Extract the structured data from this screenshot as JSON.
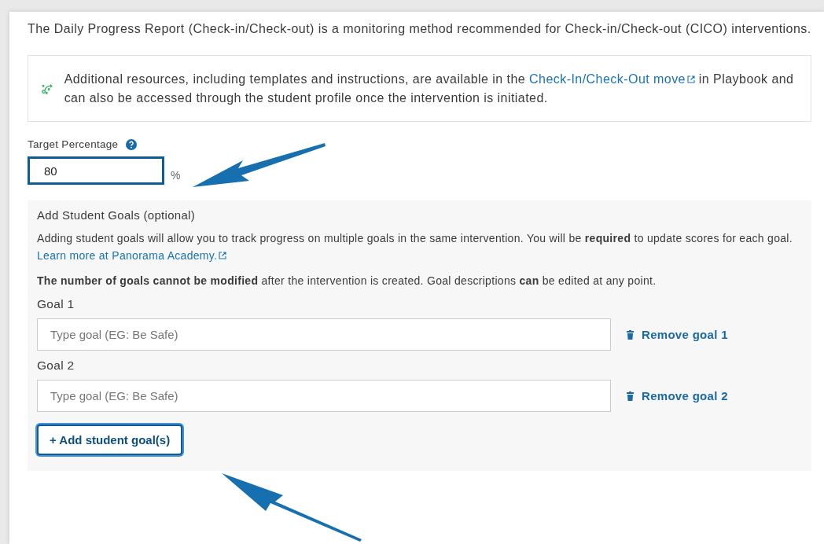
{
  "intro": "The Daily Progress Report (Check-in/Check-out) is a monitoring method recommended for Check-in/Check-out (CICO) interventions.",
  "resource_note": {
    "text_before": "Additional resources, including templates and instructions, are available in the",
    "link": "Check-In/Check-Out move",
    "text_after": "in Playbook and can also be accessed through the student profile once the intervention is initiated."
  },
  "target": {
    "label": "Target Percentage",
    "value": "80",
    "unit": "%",
    "focused": true
  },
  "goals_section": {
    "title": "Add Student Goals (optional)",
    "description": "Adding student goals will allow you to track progress on multiple goals in the same intervention. You will be **required** to update scores for each goal.",
    "description_link": "Learn more at Panorama Academy.",
    "notice": "**The number of goals cannot be modified** after the intervention is created. Goal descriptions **can** be edited at any point.",
    "goals": [
      {
        "label": "Goal 1",
        "placeholder": "Type goal (EG: Be Safe)",
        "remove": "Remove goal 1"
      },
      {
        "label": "Goal 2",
        "placeholder": "Type goal (EG: Be Safe)",
        "remove": "Remove goal 2"
      }
    ],
    "add_button": {
      "label": "+ Add student goal(s)",
      "focused": true
    }
  }
}
